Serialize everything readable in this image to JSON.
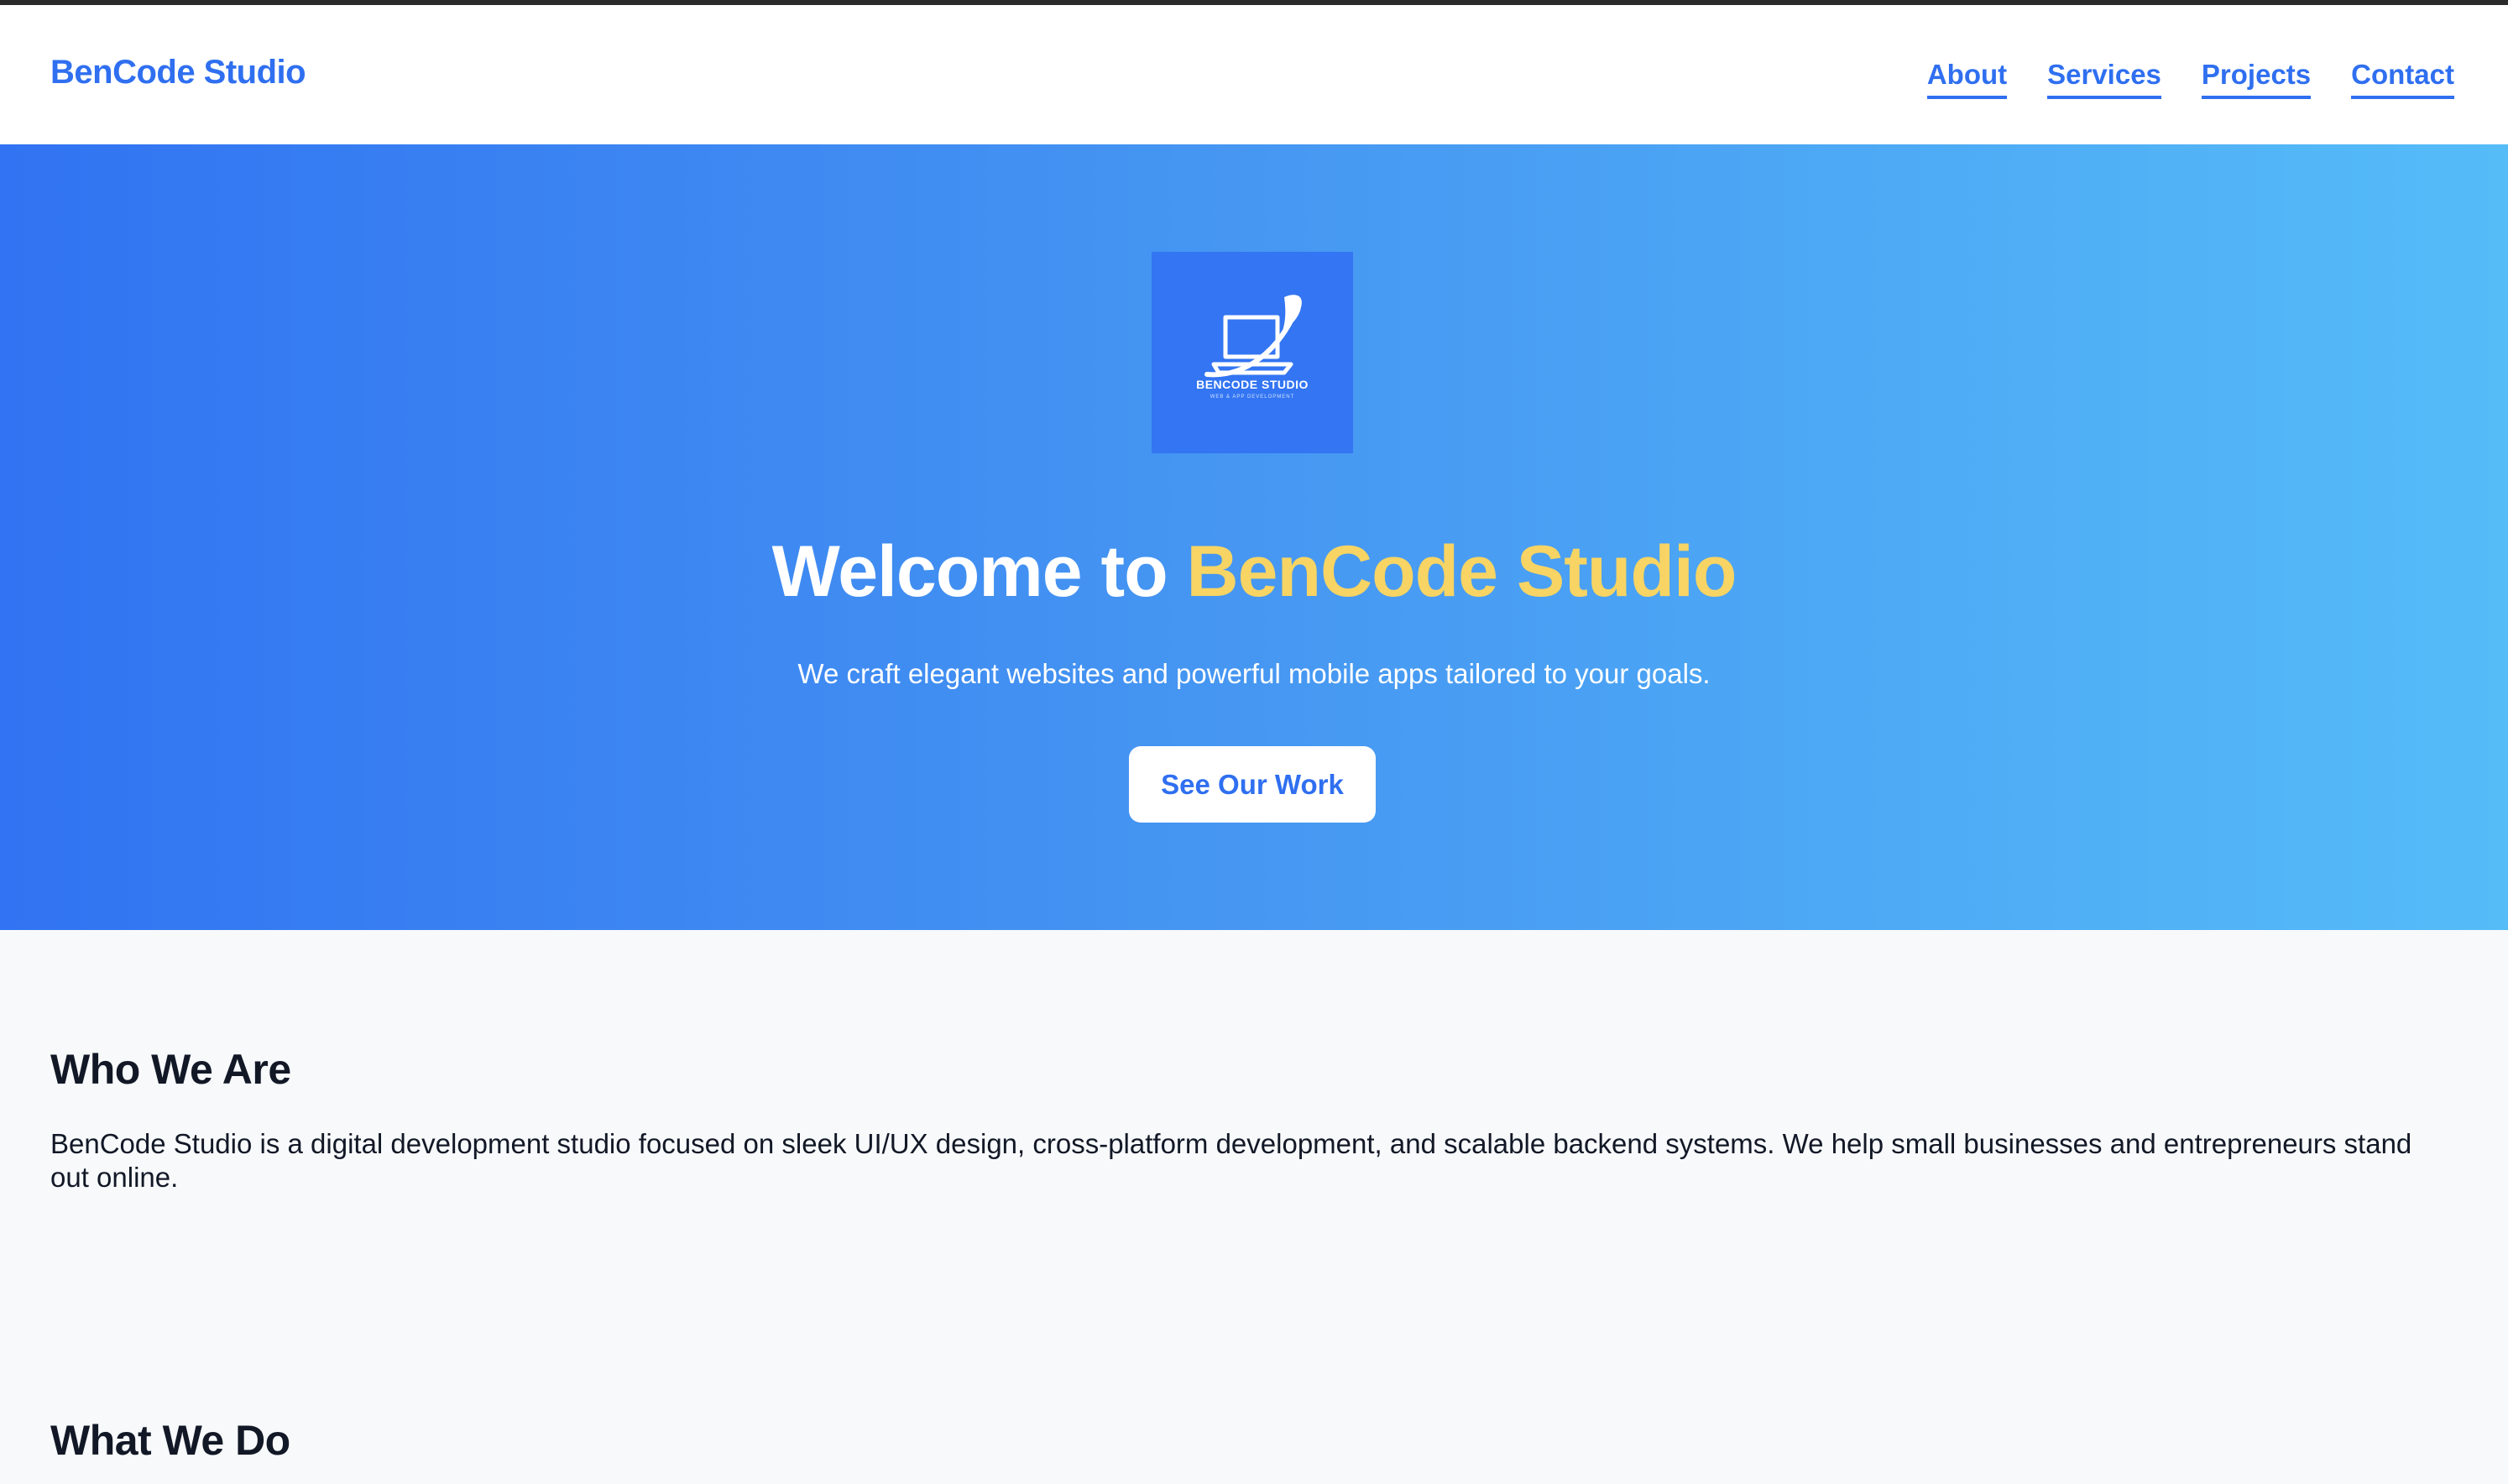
{
  "header": {
    "brand": "BenCode Studio",
    "nav": [
      "About",
      "Services",
      "Projects",
      "Contact"
    ]
  },
  "hero": {
    "logo": {
      "icon": "laptop-logo-icon",
      "text": "BENCODE STUDIO",
      "subtext": "WEB & APP DEVELOPMENT"
    },
    "title_prefix": "Welcome to",
    "title_accent": "BenCode Studio",
    "subtitle": "We craft elegant websites and powerful mobile apps tailored to your goals.",
    "cta_label": "See Our Work"
  },
  "about": {
    "heading": "Who We Are",
    "text": "BenCode Studio is a digital development studio focused on sleek UI/UX design, cross-platform development, and scalable backend systems. We help small businesses and entrepreneurs stand out online."
  },
  "services": {
    "heading": "What We Do"
  },
  "colors": {
    "brand_blue": "#2f6ff0",
    "accent_yellow": "#f7d463",
    "gradient_start": "#3173f2",
    "gradient_end": "#55bcf8",
    "page_bg": "#f7f9fb",
    "text_dark": "#121826"
  }
}
